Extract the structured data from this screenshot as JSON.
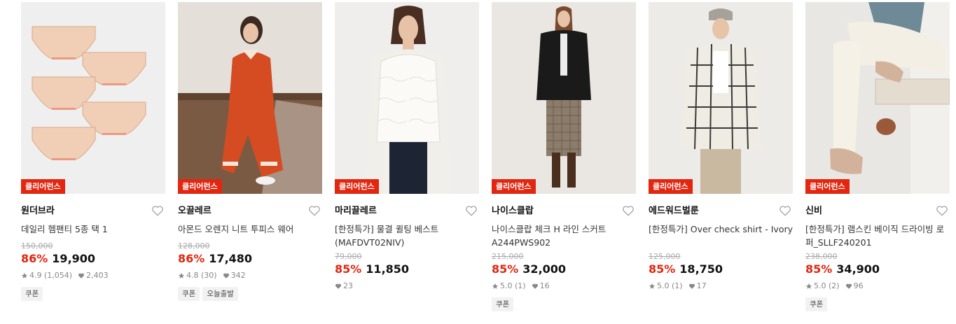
{
  "products": [
    {
      "badge": "클리어런스",
      "brand": "원더브라",
      "title": "데일리 헴팬티 5종 택 1",
      "original_price": "150,000",
      "discount": "86%",
      "price": "19,900",
      "rating": "4.9",
      "reviews": "(1,054)",
      "likes": "2,403",
      "tags": [
        "쿠폰"
      ],
      "image": "peach-panties-set"
    },
    {
      "badge": "클리어런스",
      "brand": "오끌레르",
      "title": "아몬드 오렌지 니트 투피스 웨어",
      "original_price": "128,000",
      "discount": "86%",
      "price": "17,480",
      "rating": "4.8",
      "reviews": "(30)",
      "likes": "342",
      "tags": [
        "쿠폰",
        "오늘출발"
      ],
      "image": "orange-knit-set-model"
    },
    {
      "badge": "클리어런스",
      "brand": "마리끌레르",
      "title": "[한정특가] 물결 퀼팅 베스트 (MAFDVT02NIV)",
      "original_price": "79,000",
      "discount": "85%",
      "price": "11,850",
      "rating": "",
      "reviews": "",
      "likes": "23",
      "tags": [],
      "image": "ivory-quilted-vest-model"
    },
    {
      "badge": "클리어런스",
      "brand": "나이스클랍",
      "title": "나이스클랍 체크 H 라인 스커트 A244PWS902",
      "original_price": "215,000",
      "discount": "85%",
      "price": "32,000",
      "rating": "5.0",
      "reviews": "(1)",
      "likes": "16",
      "tags": [
        "쿠폰"
      ],
      "image": "check-skirt-model"
    },
    {
      "badge": "클리어런스",
      "brand": "에드워드벌룬",
      "title": "[한정특가] Over check shirt - Ivory",
      "original_price": "125,000",
      "discount": "85%",
      "price": "18,750",
      "rating": "5.0",
      "reviews": "(1)",
      "likes": "17",
      "tags": [],
      "image": "check-shirt-model"
    },
    {
      "badge": "클리어런스",
      "brand": "신비",
      "title": "[한정특가] 램스킨 베이직 드라이빙 로퍼_SLLF240201",
      "original_price": "238,000",
      "discount": "85%",
      "price": "34,900",
      "rating": "5.0",
      "reviews": "(2)",
      "likes": "96",
      "tags": [
        "쿠폰"
      ],
      "image": "beige-loafers"
    }
  ],
  "colors": {
    "accent": "#e2260f",
    "muted": "#888888"
  }
}
